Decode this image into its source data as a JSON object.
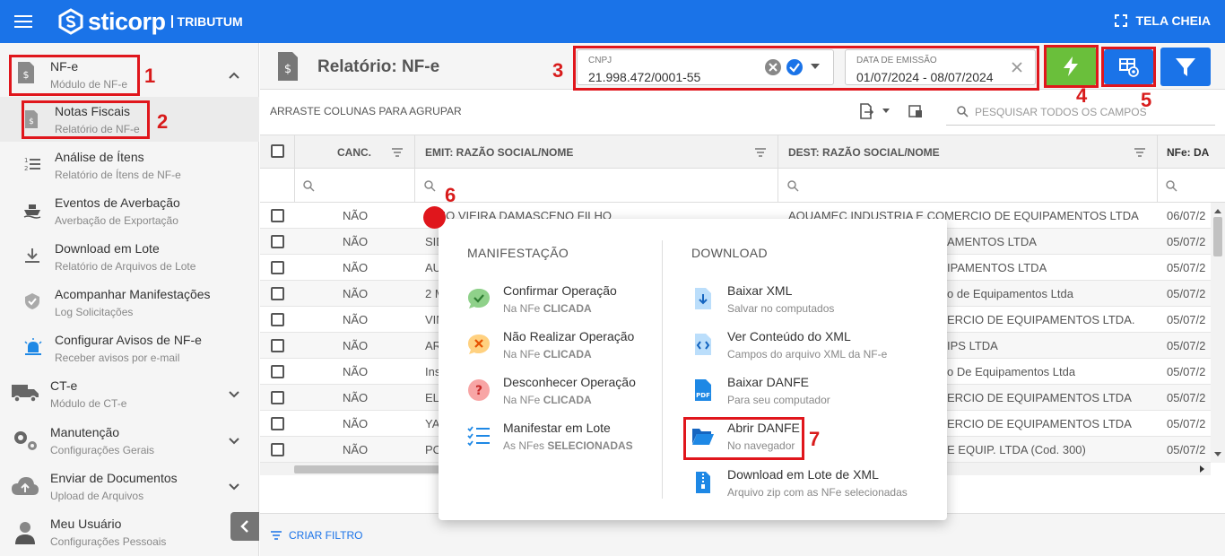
{
  "app": {
    "brand": "sticorp",
    "module": "TRIBUTUM",
    "fullscreen_label": "TELA CHEIA"
  },
  "sidebar": {
    "items": [
      {
        "title": "NF-e",
        "subtitle": "Módulo de NF-e"
      },
      {
        "title": "Notas Fiscais",
        "subtitle": "Relatório de NF-e"
      },
      {
        "title": "Análise de Ítens",
        "subtitle": "Relatório de Ítens de NF-e"
      },
      {
        "title": "Eventos de Averbação",
        "subtitle": "Averbação de Exportação"
      },
      {
        "title": "Download em Lote",
        "subtitle": "Relatório de Arquivos de Lote"
      },
      {
        "title": "Acompanhar Manifestações",
        "subtitle": "Log Solicitações"
      },
      {
        "title": "Configurar Avisos de NF-e",
        "subtitle": "Receber avisos por e-mail"
      },
      {
        "title": "CT-e",
        "subtitle": "Módulo de CT-e"
      },
      {
        "title": "Manutenção",
        "subtitle": "Configurações Gerais"
      },
      {
        "title": "Enviar de Documentos",
        "subtitle": "Upload de Arquivos"
      },
      {
        "title": "Meu Usuário",
        "subtitle": "Configurações Pessoais"
      }
    ]
  },
  "header": {
    "title": "Relatório: NF-e"
  },
  "filters": {
    "cnpj": {
      "label": "CNPJ",
      "value": "21.998.472/0001-55"
    },
    "date": {
      "label": "DATA DE EMISSÃO",
      "value": "01/07/2024 - 08/07/2024"
    }
  },
  "toolbar": {
    "group_hint": "ARRASTE COLUNAS PARA AGRUPAR",
    "search_placeholder": "PESQUISAR TODOS OS CAMPOS"
  },
  "grid": {
    "columns": [
      "CANC.",
      "EMIT: RAZÃO SOCIAL/NOME",
      "DEST: RAZÃO SOCIAL/NOME",
      "NFe: DA"
    ],
    "rows": [
      {
        "canc": "NÃO",
        "emit": "ONIO VIEIRA DAMASCENO FILHO",
        "dest": "AQUAMEC INDUSTRIA E COMERCIO DE EQUIPAMENTOS LTDA",
        "date": "06/07/2"
      },
      {
        "canc": "NÃO",
        "emit": "SID",
        "dest": "AMENTOS LTDA",
        "date": "05/07/2"
      },
      {
        "canc": "NÃO",
        "emit": "AU",
        "dest": "IPAMENTOS LTDA",
        "date": "05/07/2"
      },
      {
        "canc": "NÃO",
        "emit": "2 M",
        "dest": "o de Equipamentos Ltda",
        "date": "05/07/2"
      },
      {
        "canc": "NÃO",
        "emit": "VIN",
        "dest": "ERCIO DE EQUIPAMENTOS LTDA.",
        "date": "05/07/2"
      },
      {
        "canc": "NÃO",
        "emit": "AR",
        "dest": "IPS LTDA",
        "date": "05/07/2"
      },
      {
        "canc": "NÃO",
        "emit": "Ins",
        "dest": "o De Equipamentos Ltda",
        "date": "05/07/2"
      },
      {
        "canc": "NÃO",
        "emit": "EL",
        "dest": "ERCIO DE EQUIPAMENTOS LTDA",
        "date": "05/07/2"
      },
      {
        "canc": "NÃO",
        "emit": "YA",
        "dest": "ERCIO DE EQUIPAMENTOS LTDA",
        "date": "05/07/2"
      },
      {
        "canc": "NÃO",
        "emit": "PO",
        "dest": "E EQUIP. LTDA (Cod. 300)",
        "date": "05/07/2"
      }
    ]
  },
  "context_menu": {
    "manifestacao_title": "MANIFESTAÇÃO",
    "download_title": "DOWNLOAD",
    "manifestacao": [
      {
        "title": "Confirmar Operação",
        "sub": "Na NFe ",
        "sub_bold": "CLICADA",
        "color": "#4caf50"
      },
      {
        "title": "Não Realizar Operação",
        "sub": "Na NFe ",
        "sub_bold": "CLICADA",
        "color": "#ff9800"
      },
      {
        "title": "Desconhecer Operação",
        "sub": "Na NFe ",
        "sub_bold": "CLICADA",
        "color": "#e53935"
      },
      {
        "title": "Manifestar em Lote",
        "sub": "As NFes ",
        "sub_bold": "SELECIONADAS",
        "color": "#1e88e5"
      }
    ],
    "download": [
      {
        "title": "Baixar XML",
        "sub": "Salvar no computados"
      },
      {
        "title": "Ver Conteúdo do XML",
        "sub": "Campos do arquivo XML da NF-e"
      },
      {
        "title": "Baixar DANFE",
        "sub": "Para seu computador"
      },
      {
        "title": "Abrir DANFE",
        "sub": "No navegador"
      },
      {
        "title": "Download em Lote de XML",
        "sub": "Arquivo zip com as NFe selecionadas"
      }
    ]
  },
  "footer": {
    "create_filter": "CRIAR FILTRO"
  },
  "annotations": [
    "1",
    "2",
    "3",
    "4",
    "5",
    "6",
    "7"
  ],
  "colors": {
    "primary": "#1a73e8",
    "green": "#6abf3b",
    "annotation": "#e0161c"
  }
}
